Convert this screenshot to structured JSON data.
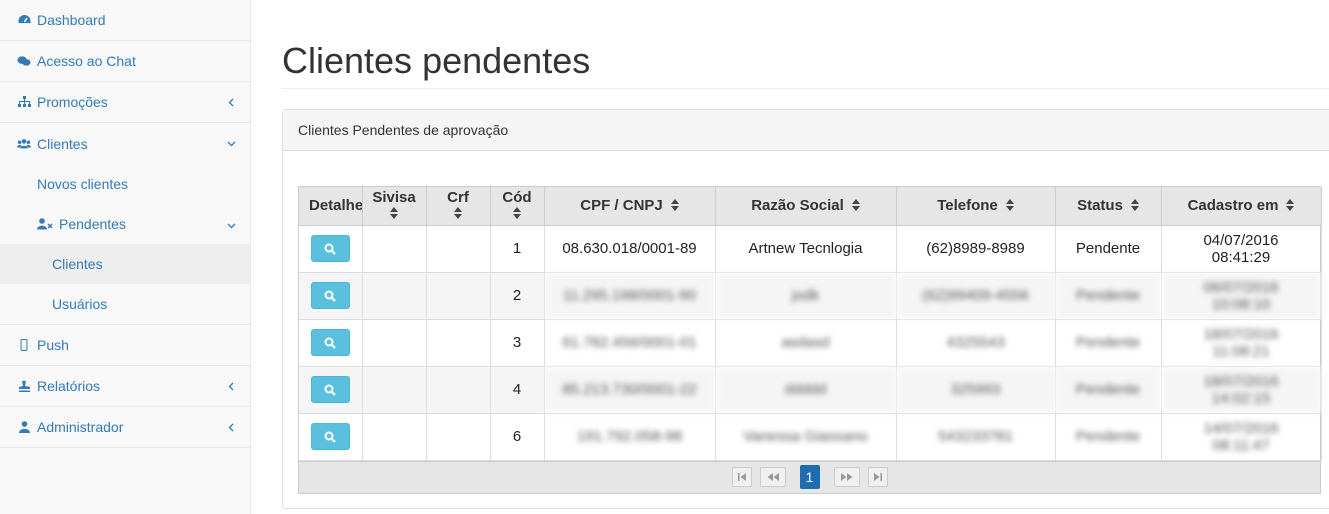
{
  "sidebar": {
    "dashboard": "Dashboard",
    "chat": "Acesso ao Chat",
    "promocoes": "Promoções",
    "clientes": "Clientes",
    "novos_clientes": "Novos clientes",
    "pendentes": "Pendentes",
    "pend_clientes": "Clientes",
    "pend_usuarios": "Usuários",
    "push": "Push",
    "relatorios": "Relatórios",
    "administrador": "Administrador"
  },
  "page": {
    "title": "Clientes pendentes",
    "panel_heading": "Clientes Pendentes de aprovação"
  },
  "table": {
    "headers": {
      "detalhe": "Detalhe",
      "sivisa": "Sivisa",
      "crf": "Crf",
      "cod": "Cód",
      "cpf": "CPF / CNPJ",
      "razao": "Razão Social",
      "telefone": "Telefone",
      "status": "Status",
      "cadastro": "Cadastro em"
    },
    "rows": [
      {
        "cod": "1",
        "cpf": "08.630.018/0001-89",
        "razao": "Artnew Tecnlogia",
        "telefone": "(62)8989-8989",
        "status": "Pendente",
        "date": "04/07/2016",
        "time": "08:41:29"
      },
      {
        "cod": "2",
        "cpf": "11.295.198/0001-90",
        "razao": "jodk",
        "telefone": "(62)99409-4556",
        "status": "Pendente",
        "date": "06/07/2016",
        "time": "10:08:10"
      },
      {
        "cod": "3",
        "cpf": "61.782.456/0001-01",
        "razao": "asdasd",
        "telefone": "4325543",
        "status": "Pendente",
        "date": "18/07/2016",
        "time": "11:08:21"
      },
      {
        "cod": "4",
        "cpf": "85.213.730/0001-22",
        "razao": "ddddd",
        "telefone": "325993",
        "status": "Pendente",
        "date": "18/07/2016",
        "time": "14:02:15"
      },
      {
        "cod": "6",
        "cpf": "191.792.058-98",
        "razao": "Vanessa Giassano",
        "telefone": "543233781",
        "status": "Pendente",
        "date": "14/07/2016",
        "time": "08:11:47"
      }
    ]
  },
  "pager": {
    "current": "1"
  },
  "colors": {
    "link": "#337ab7",
    "info_button": "#5bc0de",
    "active_page": "#1f6db1"
  }
}
